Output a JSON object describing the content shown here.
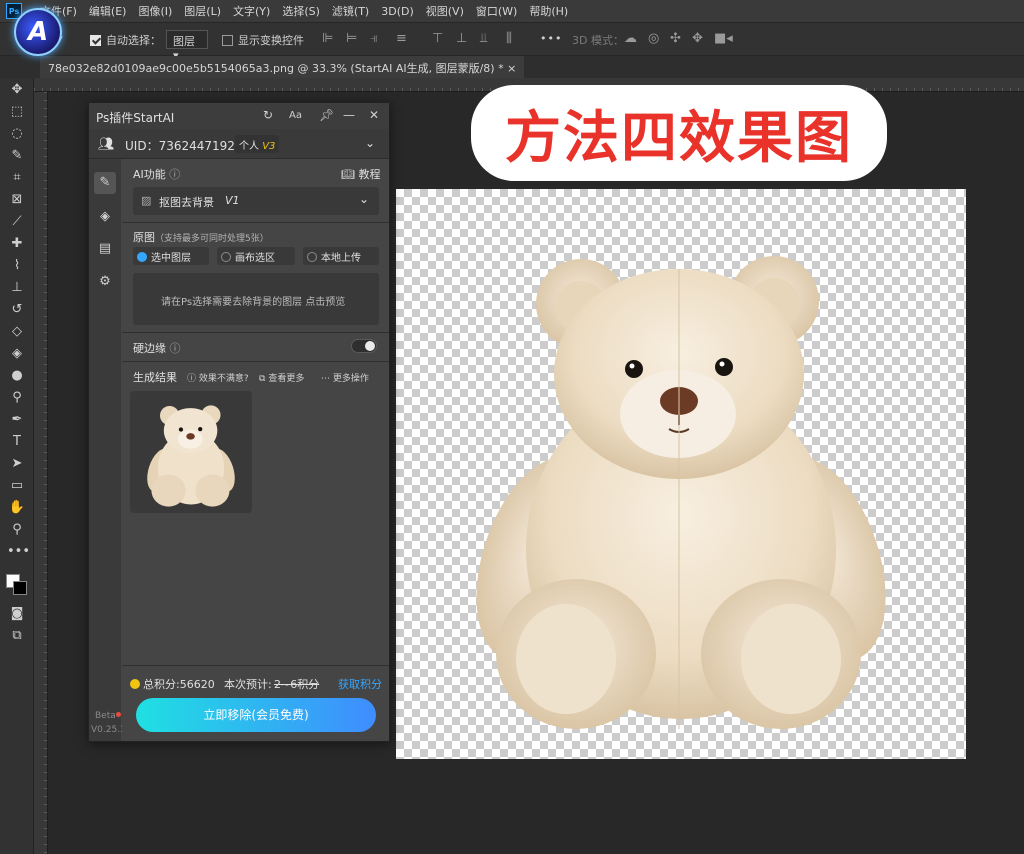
{
  "menubar": {
    "items": [
      "文件(F)",
      "编辑(E)",
      "图像(I)",
      "图层(L)",
      "文字(Y)",
      "选择(S)",
      "滤镜(T)",
      "3D(D)",
      "视图(V)",
      "窗口(W)",
      "帮助(H)"
    ]
  },
  "options": {
    "auto_select_label": "自动选择：",
    "auto_select_value": "图层",
    "show_transform_label": "显示变换控件",
    "more": "•••",
    "mode_3d": "3D 模式："
  },
  "document": {
    "tab_title": "78e032e82d0109ae9c00e5b5154065a3.png @ 33.3% (StartAI AI生成, 图层蒙版/8) *"
  },
  "headline": "方法四效果图",
  "plugin": {
    "title": "Ps插件StartAI",
    "uid_label": "UID：7362447192",
    "plan_label": "个人",
    "plan_version": "V3",
    "ai_function_label": "AI功能",
    "tutorial_label": "教程",
    "feature_select": "抠图去背景",
    "feature_version": "V1",
    "source_label": "原图",
    "source_hint": "（支持最多可同时处理5张）",
    "source_options": [
      "选中图层",
      "画布选区",
      "本地上传"
    ],
    "dropzone_text": "请在Ps选择需要去除背景的图层 点击预览",
    "hard_edge_label": "硬边缘",
    "results_label": "生成结果",
    "results_unsatisfied": "效果不满意?",
    "results_view_more": "查看更多",
    "results_more_ops": "更多操作",
    "points_total": "总积分:56620",
    "points_estimate_label": "本次预计:",
    "points_estimate_value": "2~6积分",
    "get_points": "获取积分",
    "action_button": "立即移除(会员免费)",
    "beta_label": "Beta",
    "version_label": "V0.25.3"
  },
  "colors": {
    "accent": "#35a7ff",
    "headline_red": "#e8322a",
    "button_gradient_start": "#1fe0e2",
    "button_gradient_end": "#3f8cff"
  }
}
